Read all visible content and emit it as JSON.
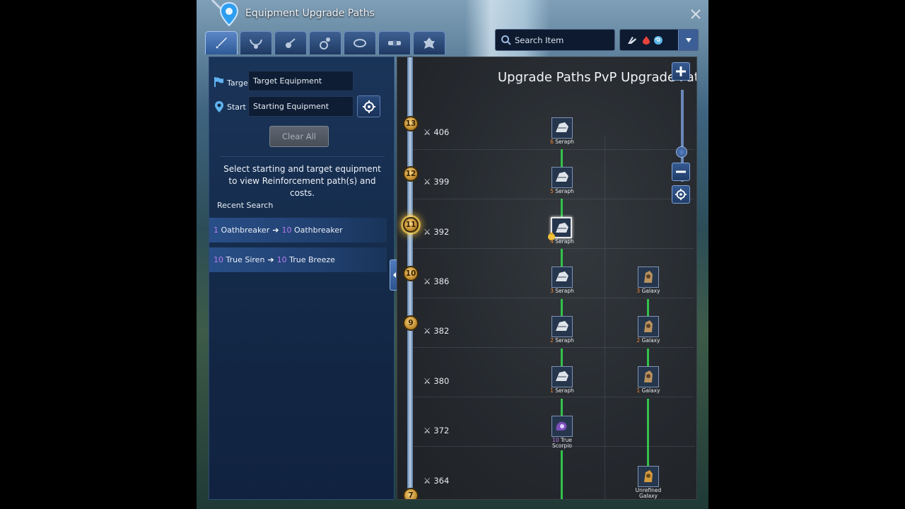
{
  "window": {
    "title": "Equipment Upgrade Paths"
  },
  "tabs": [
    {
      "icon": "sword-icon"
    },
    {
      "icon": "necklace-icon"
    },
    {
      "icon": "earring-icon"
    },
    {
      "icon": "ring-icon"
    },
    {
      "icon": "bracelet-icon"
    },
    {
      "icon": "belt-icon"
    },
    {
      "icon": "soul-icon"
    }
  ],
  "search": {
    "label": "Search Item"
  },
  "filter": {
    "icons": [
      "gauntlet-icon",
      "fire-element-icon",
      "wind-element-icon"
    ]
  },
  "left": {
    "target_label": "Target",
    "target_value": "Target Equipment",
    "start_label": "Start",
    "start_value": "Starting Equipment",
    "clear_label": "Clear All",
    "hint": "Select starting and target equipment to view Reinforcement path(s) and costs.",
    "recent_title": "Recent Search",
    "recent": [
      {
        "from_lv": "1",
        "from": "Oathbreaker",
        "to_lv": "10",
        "to": "Oathbreaker"
      },
      {
        "from_lv": "10",
        "from": "True Siren",
        "to_lv": "10",
        "to": "True Breeze"
      }
    ]
  },
  "graph": {
    "header_upgrade": "Upgrade Paths",
    "header_pvp": "PvP Upgrade Path",
    "levels": [
      {
        "coin": "13",
        "ap": "406"
      },
      {
        "coin": "12",
        "ap": "399"
      },
      {
        "coin": "11",
        "ap": "392",
        "selected": true
      },
      {
        "coin": "10",
        "ap": "386"
      },
      {
        "coin": "9",
        "ap": "382"
      },
      {
        "coin": "",
        "ap": "380"
      },
      {
        "coin": "",
        "ap": "372"
      },
      {
        "coin": "",
        "ap": "364"
      },
      {
        "coin": "7",
        "ap": ""
      }
    ],
    "upgrade_nodes": [
      {
        "n": "6",
        "name": "Seraph"
      },
      {
        "n": "5",
        "name": "Seraph"
      },
      {
        "n": "4",
        "name": "Seraph",
        "selected": true
      },
      {
        "n": "3",
        "name": "Seraph"
      },
      {
        "n": "2",
        "name": "Seraph"
      },
      {
        "n": "1",
        "name": "Seraph"
      },
      {
        "n": "10",
        "name": "True",
        "name2": "Scorpio"
      }
    ],
    "pvp_nodes": [
      {
        "n": "3",
        "name": "Galaxy"
      },
      {
        "n": "2",
        "name": "Galaxy"
      },
      {
        "n": "1",
        "name": "Galaxy"
      },
      {
        "n": "",
        "name": "Unrefined",
        "name2": "Galaxy"
      }
    ]
  },
  "colors": {
    "accent": "#3b5e96",
    "path_green": "#33c24a",
    "level_purple": "#b87cf0",
    "count_orange": "#f08a3a"
  }
}
